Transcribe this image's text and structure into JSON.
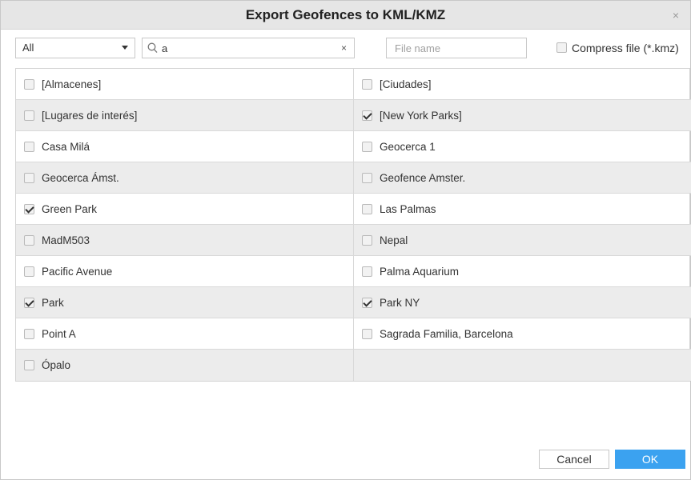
{
  "dialog": {
    "title": "Export Geofences to KML/KMZ",
    "close_symbol": "×"
  },
  "toolbar": {
    "filter_value": "All",
    "search_value": "a",
    "search_clear_symbol": "×",
    "filename_placeholder": "File name",
    "compress_label": "Compress file (*.kmz)",
    "compress_checked": false
  },
  "geofences": [
    {
      "name": "[Almacenes]",
      "checked": false
    },
    {
      "name": "[Ciudades]",
      "checked": false
    },
    {
      "name": "[Lugares de interés]",
      "checked": false
    },
    {
      "name": "[New York Parks]",
      "checked": true
    },
    {
      "name": "Casa Milá",
      "checked": false
    },
    {
      "name": "Geocerca 1",
      "checked": false
    },
    {
      "name": "Geocerca Ámst.",
      "checked": false
    },
    {
      "name": "Geofence Amster.",
      "checked": false
    },
    {
      "name": "Green Park",
      "checked": true
    },
    {
      "name": "Las Palmas",
      "checked": false
    },
    {
      "name": "MadM503",
      "checked": false
    },
    {
      "name": "Nepal",
      "checked": false
    },
    {
      "name": "Pacific Avenue",
      "checked": false
    },
    {
      "name": "Palma Aquarium",
      "checked": false
    },
    {
      "name": "Park",
      "checked": true
    },
    {
      "name": "Park NY",
      "checked": true
    },
    {
      "name": "Point A",
      "checked": false
    },
    {
      "name": "Sagrada Familia, Barcelona",
      "checked": false
    },
    {
      "name": "Ópalo",
      "checked": false
    }
  ],
  "footer": {
    "cancel_label": "Cancel",
    "ok_label": "OK"
  },
  "colors": {
    "accent": "#3ba2f0",
    "titlebar_bg": "#e6e6e6",
    "row_alt_bg": "#ececec"
  },
  "icons": [
    "close-icon",
    "chevron-down-icon",
    "search-icon",
    "clear-icon",
    "checkbox-icon"
  ]
}
